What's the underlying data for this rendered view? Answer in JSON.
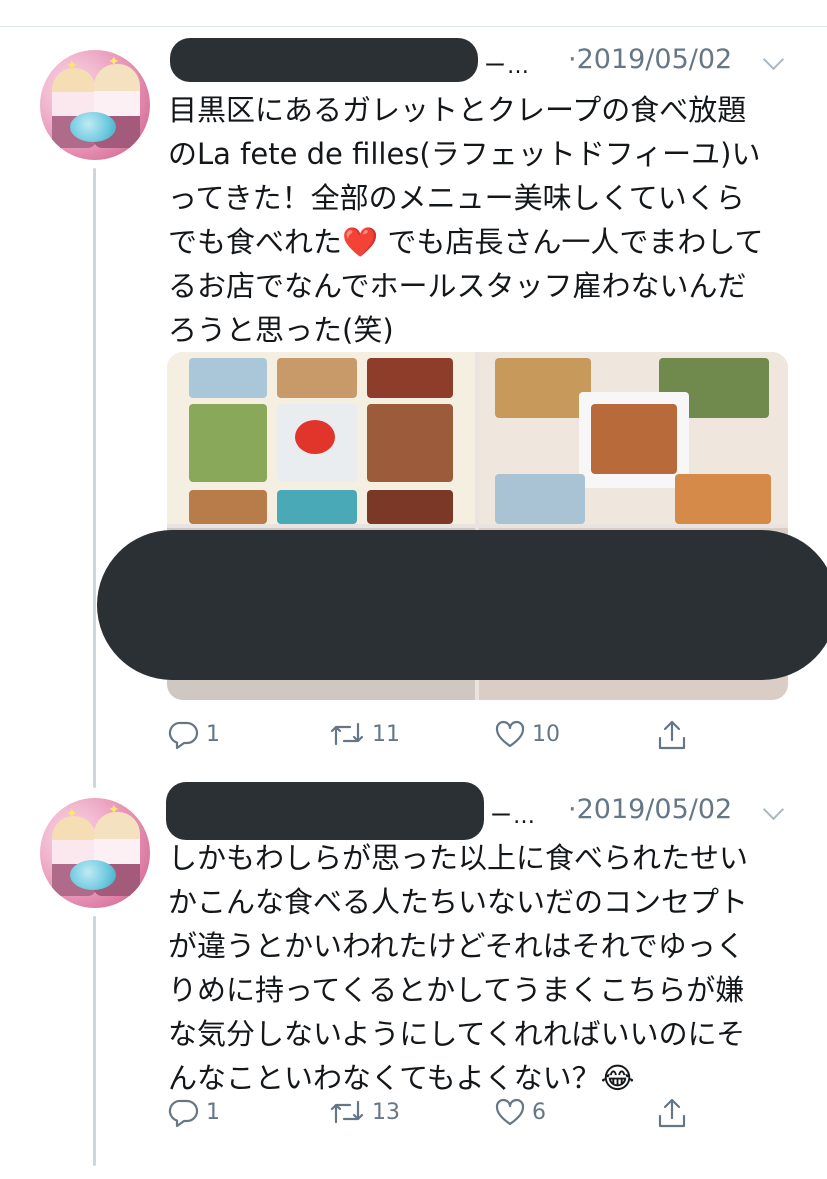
{
  "tweets": [
    {
      "handle_tail": "ー…",
      "date": "·2019/05/02",
      "text": "目黒区にあるガレットとクレープの食べ放題\nのLa fete de filles(ラフェットドフィーユ)い\nってきた！全部のメニュー美味しくていくら\nでも食べれた❤️ でも店長さん一人でまわして\nるお店でなんでホールスタッフ雇わないんだ\nろうと思った(笑)",
      "replies": "1",
      "retweets": "11",
      "likes": "10"
    },
    {
      "handle_tail": "ー…",
      "date": "·2019/05/02",
      "text": "しかもわしらが思った以上に食べられたせい\nかこんな食べる人たちいないだのコンセプト\nが違うとかいわれたけどそれはそれでゆっく\nりめに持ってくるとかしてうまくこちらが嫌\nな気分しないようにしてくれればいいのにそ\nんなこといわなくてもよくない？😂",
      "replies": "1",
      "retweets": "13",
      "likes": "6"
    }
  ],
  "icons": {
    "reply": "reply-icon",
    "retweet": "retweet-icon",
    "like": "heart-icon",
    "share": "share-icon",
    "more": "chevron-down-icon"
  },
  "colors": {
    "text": "#14171a",
    "muted": "#657786",
    "thread_line": "#ccd6dd",
    "redaction": "#2b3035"
  }
}
